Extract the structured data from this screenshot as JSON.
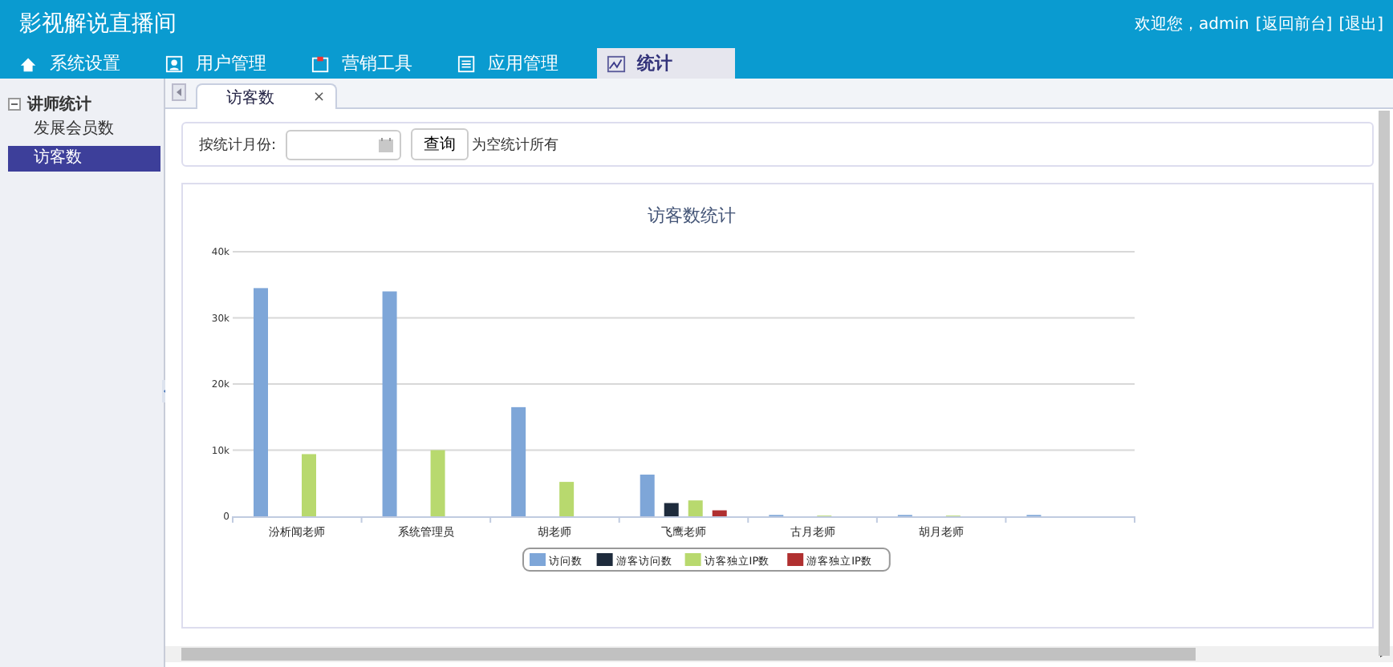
{
  "header": {
    "title": "影视解说直播间",
    "welcome": "欢迎您，admin",
    "links": [
      "[返回前台]",
      "[退出]"
    ]
  },
  "nav": [
    {
      "label": "系统设置",
      "kind": "home",
      "selected": false
    },
    {
      "label": "用户管理",
      "kind": "user",
      "selected": false
    },
    {
      "label": "营销工具",
      "kind": "box",
      "selected": false
    },
    {
      "label": "应用管理",
      "kind": "list",
      "selected": false
    },
    {
      "label": "统计",
      "kind": "chart",
      "selected": true
    }
  ],
  "sidebar": {
    "items": [
      {
        "label": "讲师统计",
        "expanded": true,
        "selected": false,
        "children": [
          {
            "label": "发展会员数",
            "selected": false
          },
          {
            "label": "访客数",
            "selected": true
          }
        ]
      }
    ]
  },
  "tabs": [
    {
      "label": "访客数",
      "selected": true,
      "close": "×"
    }
  ],
  "query": {
    "label": "按统计月份:",
    "button": "查询",
    "hint": "为空统计所有"
  },
  "chart": {
    "chart_data": {
      "type": "bar",
      "title": "访客数统计",
      "categories": [
        "汾析闻老师",
        "系统管理员",
        "胡老师",
        "飞鹰老师",
        "古月老师",
        "胡月老师",
        null
      ],
      "series": [
        {
          "name": "访问数",
          "color": "#7ea6d8",
          "values": [
            34500,
            34000,
            16500,
            6300,
            200,
            200,
            200
          ]
        },
        {
          "name": "游客访问数",
          "color": "#1e2b3c",
          "values": [
            0,
            0,
            0,
            2000,
            0,
            0,
            0
          ]
        },
        {
          "name": "访客独立IP数",
          "color": "#b8d96e",
          "values": [
            9400,
            10000,
            5200,
            2400,
            100,
            100,
            0
          ]
        },
        {
          "name": "游客独立IP数",
          "color": "#b03030",
          "values": [
            0,
            0,
            0,
            900,
            0,
            0,
            0
          ]
        }
      ],
      "ylim": [
        0,
        40000
      ],
      "grid": true,
      "legend": true,
      "yticks": [
        {
          "value": 0,
          "label": "0"
        },
        {
          "value": 10000,
          "label": "10k"
        },
        {
          "value": 20000,
          "label": "20k"
        },
        {
          "value": 30000,
          "label": "30k"
        },
        {
          "value": 40000,
          "label": "40k"
        }
      ]
    }
  }
}
